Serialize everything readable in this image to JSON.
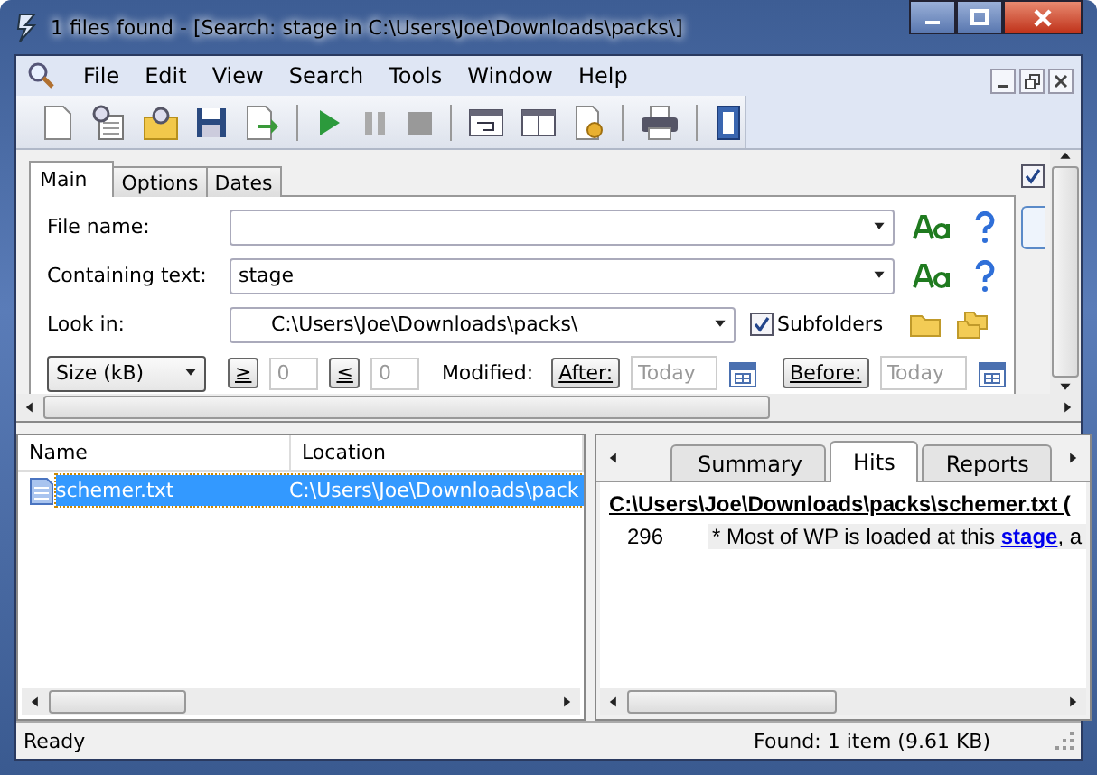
{
  "window": {
    "title": "1 files found - [Search: stage in C:\\Users\\Joe\\Downloads\\packs\\]"
  },
  "menu": [
    "File",
    "Edit",
    "View",
    "Search",
    "Tools",
    "Window",
    "Help"
  ],
  "search_tabs": [
    {
      "label": "Main",
      "selected": true
    },
    {
      "label": "Options",
      "selected": false
    },
    {
      "label": "Dates",
      "selected": false
    }
  ],
  "panel_checkbox": {
    "checked": true
  },
  "form": {
    "file_name": {
      "label": "File name:"
    },
    "containing_text": {
      "label": "Containing text:",
      "value": "stage"
    },
    "look_in": {
      "label": "Look in:",
      "value": "C:\\Users\\Joe\\Downloads\\packs\\"
    },
    "subfolders": {
      "label": "Subfolders",
      "checked": true
    },
    "size_filter": {
      "value": "Size (kB)"
    },
    "at_least": {
      "button": "≥",
      "placeholder": "0"
    },
    "at_most": {
      "button": "≤",
      "placeholder": "0"
    },
    "modified_label": "Modified:",
    "after": {
      "button": "After:",
      "placeholder": "Today"
    },
    "before": {
      "button": "Before:",
      "placeholder": "Today"
    }
  },
  "results": {
    "columns": [
      "Name",
      "Location"
    ],
    "rows": [
      {
        "name": "schemer.txt",
        "location": "C:\\Users\\Joe\\Downloads\\pack",
        "selected": true
      }
    ]
  },
  "preview": {
    "tabs": [
      {
        "label": "Summary",
        "selected": false
      },
      {
        "label": "Hits",
        "selected": true
      },
      {
        "label": "Reports",
        "selected": false
      }
    ],
    "file_heading": "C:\\Users\\Joe\\Downloads\\packs\\schemer.txt   (",
    "hits": [
      {
        "line": "296",
        "before": "* Most of WP is loaded at this ",
        "match": "stage",
        "after": ", a"
      }
    ]
  },
  "status_bar": {
    "left": "Ready",
    "right": "Found: 1 item (9.61 KB)"
  }
}
